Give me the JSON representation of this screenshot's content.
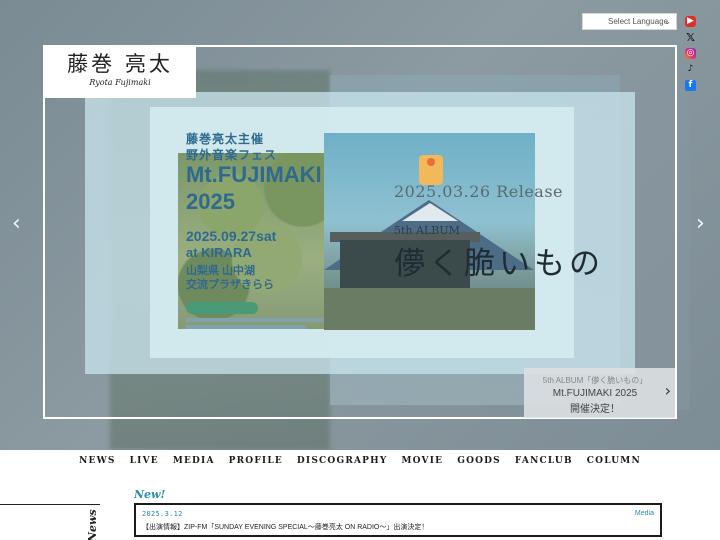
{
  "language_select": {
    "label": "Select Language"
  },
  "logo": {
    "jp": "藤巻 亮太",
    "en": "Ryota Fujimaki"
  },
  "social": [
    {
      "icon": "youtube-icon",
      "glyph": "▶"
    },
    {
      "icon": "x-icon",
      "glyph": "𝕏"
    },
    {
      "icon": "instagram-icon",
      "glyph": "◎"
    },
    {
      "icon": "tiktok-icon",
      "glyph": "♪"
    },
    {
      "icon": "facebook-icon",
      "glyph": "f"
    }
  ],
  "slider": {
    "prev_glyph": "‹",
    "next_glyph": "›",
    "poster": {
      "line1": "藤巻亮太主催",
      "line2": "野外音楽フェス",
      "line3": "Mt.FUJIMAKI",
      "line4": "2025",
      "line5": "2025.09.27sat",
      "line6": "at KIRARA",
      "line7": "山梨県 山中湖",
      "line8": "交流プラザきらら"
    },
    "album": {
      "date": "2025.03.26 Release",
      "kind": "5th ALBUM",
      "title": "儚く脆いもの"
    },
    "caption": {
      "line1": "5th ALBUM「儚く脆いもの」",
      "line2": "Mt.FUJIMAKI 2025",
      "line3": "開催決定！",
      "arrow": "›"
    }
  },
  "nav": {
    "items": [
      "NEWS",
      "LIVE",
      "MEDIA",
      "PROFILE",
      "DISCOGRAPHY",
      "MOVIE",
      "GOODS",
      "FANCLUB",
      "COLUMN"
    ]
  },
  "news": {
    "section_label": "News",
    "new_mark": "New!",
    "item": {
      "date": "2025.3.12",
      "category": "Media",
      "title": "【出演情報】ZIP-FM「SUNDAY EVENING SPECIAL～藤巻亮太 ON RADIO～」出演決定！"
    }
  }
}
